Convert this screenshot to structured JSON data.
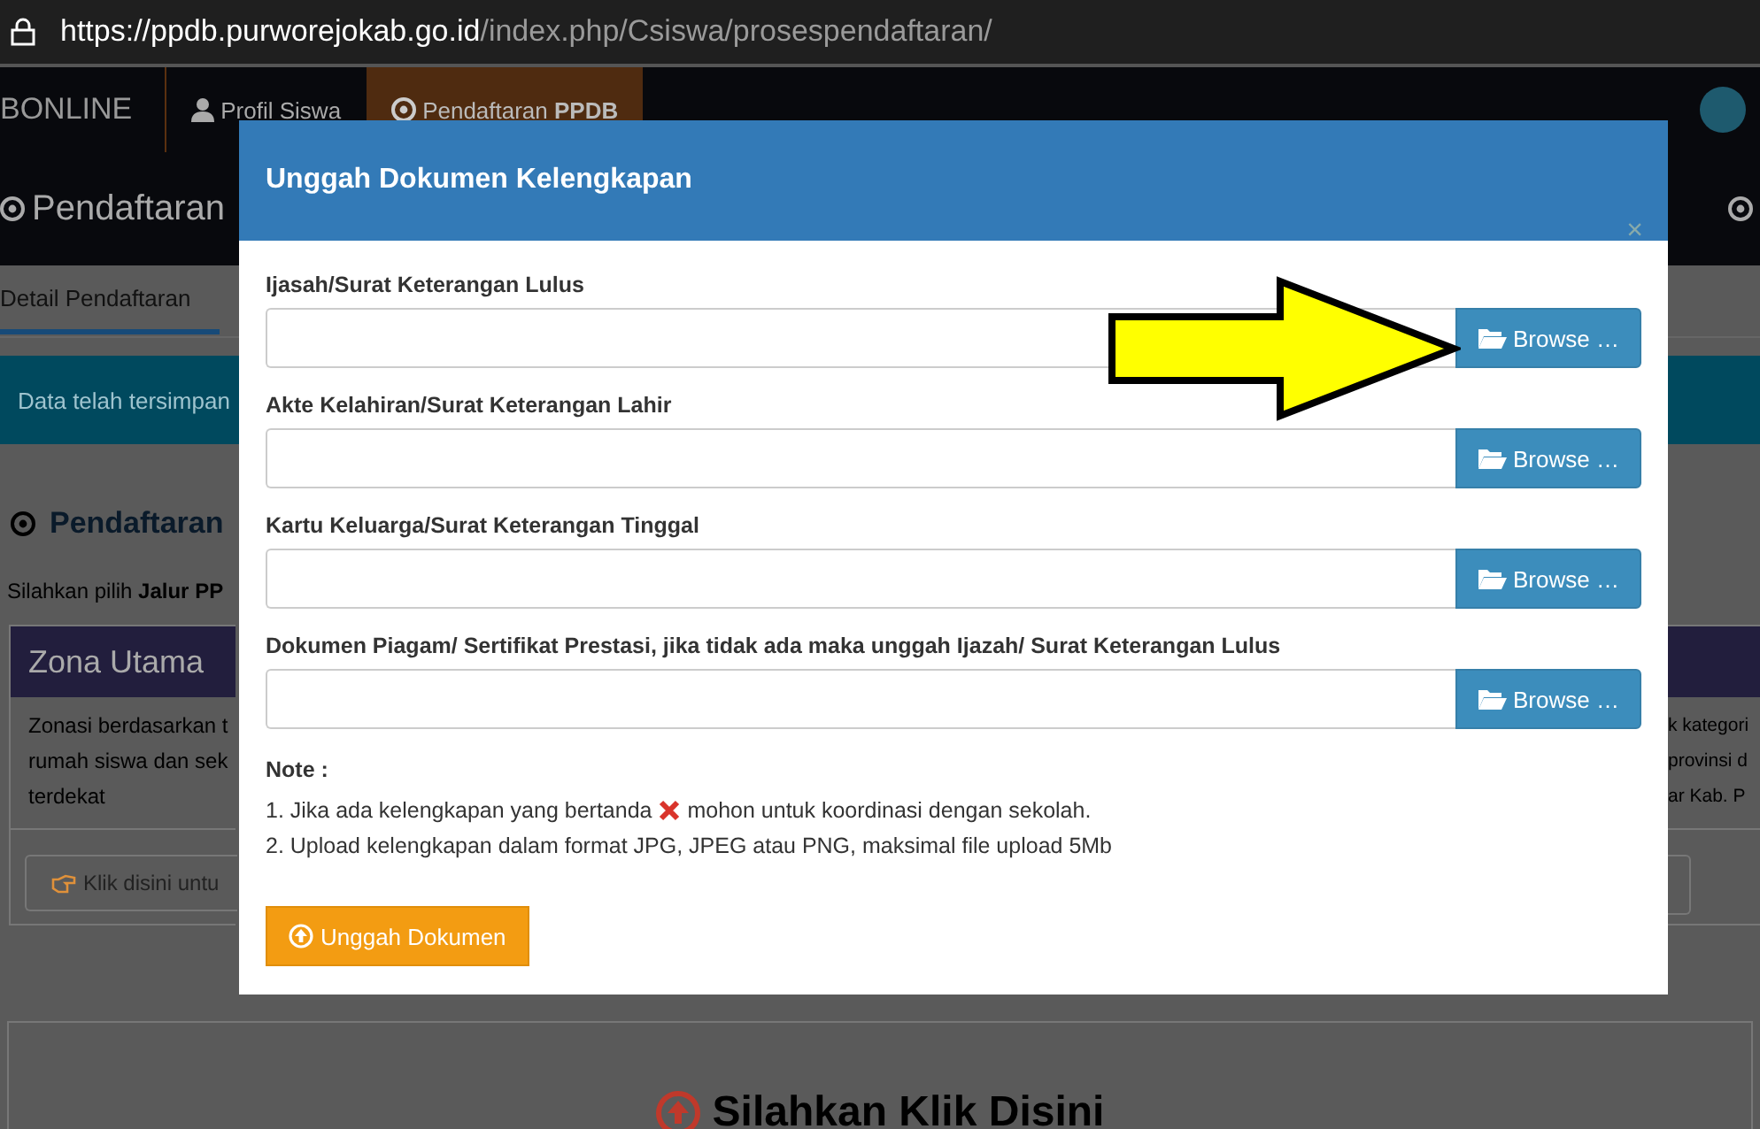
{
  "address_bar": {
    "host": "https://ppdb.purworejokab.go.id",
    "path": "/index.php/Csiswa/prosespendaftaran/"
  },
  "navbar": {
    "brand": "BONLINE",
    "items": [
      {
        "label": "Profil Siswa",
        "selected": false
      },
      {
        "label": "Pendaftaran **PPDB**",
        "selected": true
      }
    ]
  },
  "page_title": "Pendaftaran",
  "tabs": [
    {
      "label": "Detail Pendaftaran",
      "selected": true
    }
  ],
  "alert": "Data telah tersimpan",
  "section_title": "Pendaftaran",
  "instruction": "Silahkan pilih **Jalur PP**",
  "zone_card": {
    "title": "Zona Utama",
    "description_lines": [
      "Zonasi berdasarkan t",
      "rumah siswa dan sek",
      "terdekat"
    ],
    "button": "Klik disini untu"
  },
  "right_card": {
    "description_lines": [
      "k kategori",
      "provinsi d",
      "ar Kab. P"
    ]
  },
  "bottom_panel": {
    "title": "Silahkan Klik Disini"
  },
  "modal": {
    "title": "Unggah Dokumen Kelengkapan",
    "close": "×",
    "fields": [
      {
        "label": "Ijasah/Surat Keterangan Lulus",
        "button": "Browse …"
      },
      {
        "label": "Akte Kelahiran/Surat Keterangan Lahir",
        "button": "Browse …"
      },
      {
        "label": "Kartu Keluarga/Surat Keterangan Tinggal",
        "button": "Browse …"
      },
      {
        "label": "Dokumen Piagam/ Sertifikat Prestasi, jika tidak ada maka unggah Ijazah/ Surat Keterangan Lulus",
        "button": "Browse …"
      }
    ],
    "note": {
      "title": "Note :",
      "items": [
        {
          "kind": "mark",
          "before": "1. Jika ada kelengkapan yang bertanda",
          "after": "mohon untuk koordinasi dengan sekolah."
        },
        {
          "kind": "text",
          "text": "2. Upload kelengkapan dalam format JPG, JPEG atau PNG, maksimal file upload 5Mb"
        }
      ]
    },
    "submit": "Unggah Dokumen"
  }
}
